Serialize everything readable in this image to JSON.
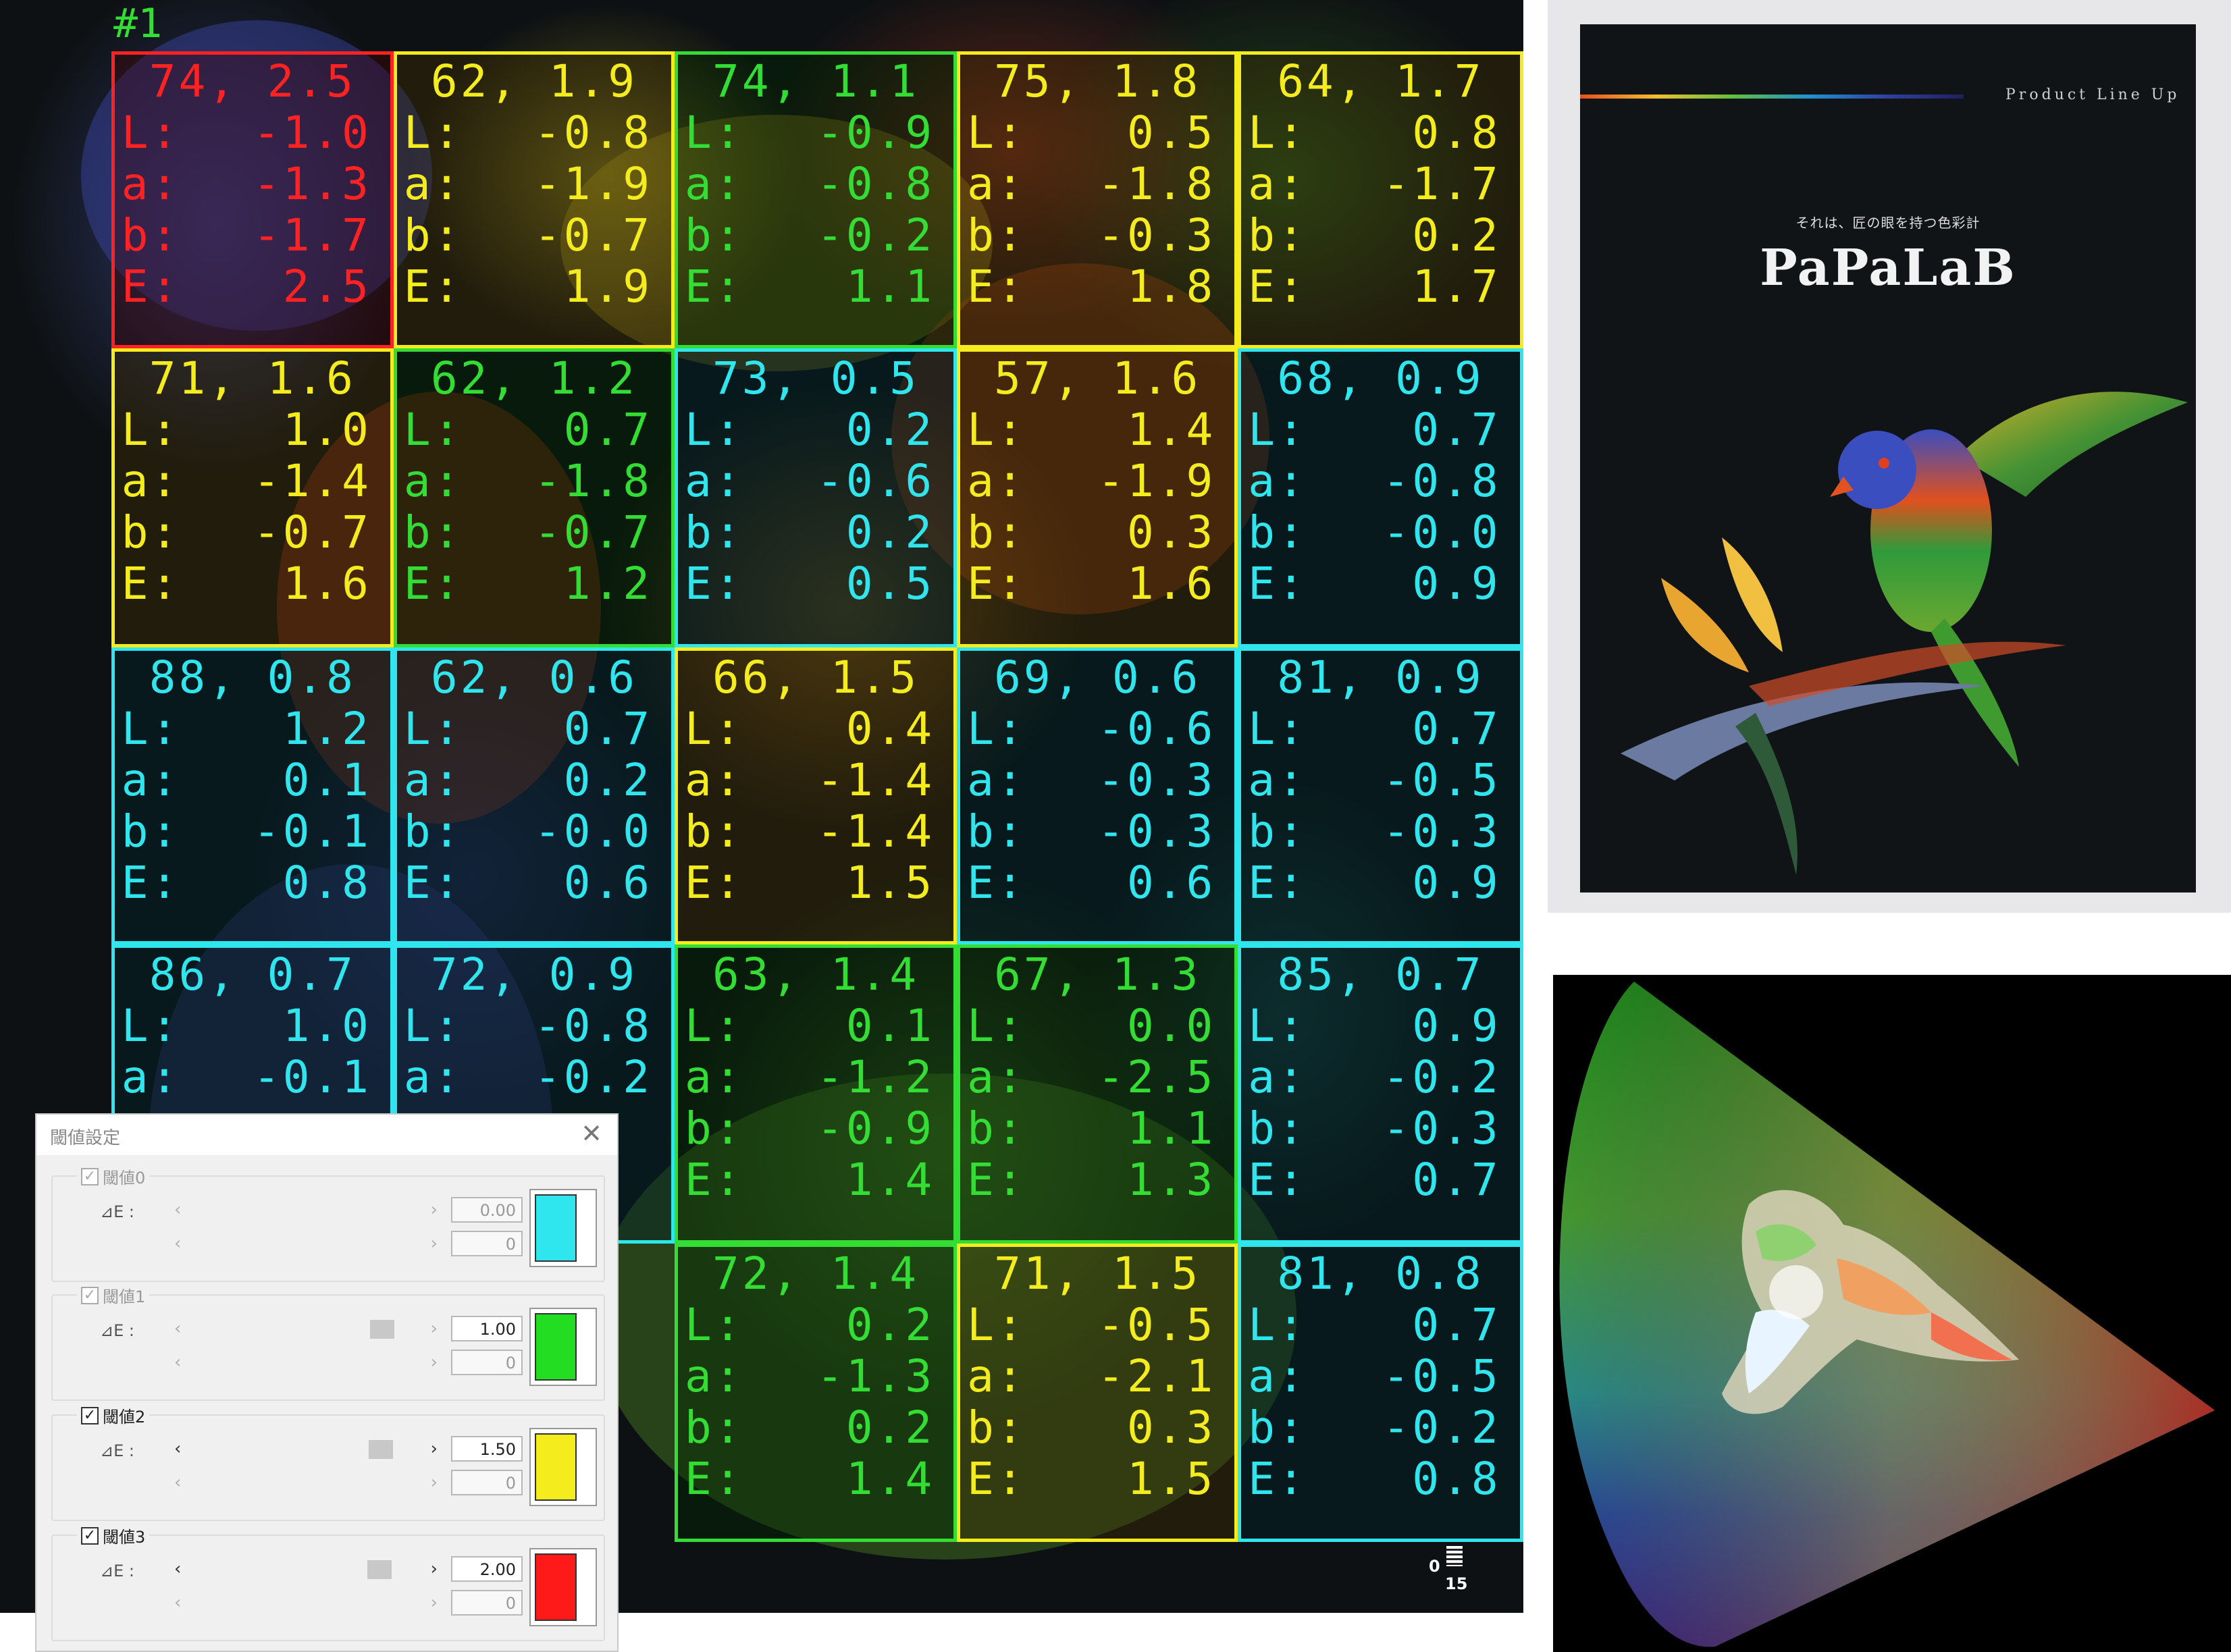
{
  "main": {
    "title": "#1",
    "scale": {
      "top": "0",
      "bottom": "15"
    },
    "cells": [
      {
        "level": "red",
        "cap": "74, 2.5",
        "L": "-1.0",
        "a": "-1.3",
        "b": "-1.7",
        "E": "2.5"
      },
      {
        "level": "yellow",
        "cap": "62, 1.9",
        "L": "-0.8",
        "a": "-1.9",
        "b": "-0.7",
        "E": "1.9"
      },
      {
        "level": "green",
        "cap": "74, 1.1",
        "L": "-0.9",
        "a": "-0.8",
        "b": "-0.2",
        "E": "1.1"
      },
      {
        "level": "yellow",
        "cap": "75, 1.8",
        "L": "0.5",
        "a": "-1.8",
        "b": "-0.3",
        "E": "1.8"
      },
      {
        "level": "yellow",
        "cap": "64, 1.7",
        "L": "0.8",
        "a": "-1.7",
        "b": "0.2",
        "E": "1.7"
      },
      {
        "level": "yellow",
        "cap": "71, 1.6",
        "L": "1.0",
        "a": "-1.4",
        "b": "-0.7",
        "E": "1.6"
      },
      {
        "level": "green",
        "cap": "62, 1.2",
        "L": "0.7",
        "a": "-1.8",
        "b": "-0.7",
        "E": "1.2"
      },
      {
        "level": "cyan",
        "cap": "73, 0.5",
        "L": "0.2",
        "a": "-0.6",
        "b": "0.2",
        "E": "0.5"
      },
      {
        "level": "yellow",
        "cap": "57, 1.6",
        "L": "1.4",
        "a": "-1.9",
        "b": "0.3",
        "E": "1.6"
      },
      {
        "level": "cyan",
        "cap": "68, 0.9",
        "L": "0.7",
        "a": "-0.8",
        "b": "-0.0",
        "E": "0.9"
      },
      {
        "level": "cyan",
        "cap": "88, 0.8",
        "L": "1.2",
        "a": "0.1",
        "b": "-0.1",
        "E": "0.8"
      },
      {
        "level": "cyan",
        "cap": "62, 0.6",
        "L": "0.7",
        "a": "0.2",
        "b": "-0.0",
        "E": "0.6"
      },
      {
        "level": "yellow",
        "cap": "66, 1.5",
        "L": "0.4",
        "a": "-1.4",
        "b": "-1.4",
        "E": "1.5"
      },
      {
        "level": "cyan",
        "cap": "69, 0.6",
        "L": "-0.6",
        "a": "-0.3",
        "b": "-0.3",
        "E": "0.6"
      },
      {
        "level": "cyan",
        "cap": "81, 0.9",
        "L": "0.7",
        "a": "-0.5",
        "b": "-0.3",
        "E": "0.9"
      },
      {
        "level": "cyan",
        "cap": "86, 0.7",
        "L": "1.0",
        "a": "-0.1",
        "b": "",
        "E": ""
      },
      {
        "level": "cyan",
        "cap": "72, 0.9",
        "L": "-0.8",
        "a": "-0.2",
        "b": "",
        "E": ""
      },
      {
        "level": "green",
        "cap": "63, 1.4",
        "L": "0.1",
        "a": "-1.2",
        "b": "-0.9",
        "E": "1.4"
      },
      {
        "level": "green",
        "cap": "67, 1.3",
        "L": "0.0",
        "a": "-2.5",
        "b": "1.1",
        "E": "1.3"
      },
      {
        "level": "cyan",
        "cap": "85, 0.7",
        "L": "0.9",
        "a": "-0.2",
        "b": "-0.3",
        "E": "0.7"
      },
      {
        "level": "hidden",
        "cap": "",
        "L": "",
        "a": "",
        "b": "",
        "E": ""
      },
      {
        "level": "hidden",
        "cap": "",
        "L": "",
        "a": "",
        "b": "",
        "E": ""
      },
      {
        "level": "green",
        "cap": "72, 1.4",
        "L": "0.2",
        "a": "-1.3",
        "b": "0.2",
        "E": "1.4"
      },
      {
        "level": "yellow",
        "cap": "71, 1.5",
        "L": "-0.5",
        "a": "-2.1",
        "b": "0.3",
        "E": "1.5"
      },
      {
        "level": "cyan",
        "cap": "81, 0.8",
        "L": "0.7",
        "a": "-0.5",
        "b": "-0.2",
        "E": "0.8"
      }
    ]
  },
  "dialog": {
    "title": "閾値設定",
    "delta_label": "⊿E :",
    "groups": [
      {
        "label": "閾値0",
        "checked": true,
        "enabled": false,
        "value": "0.00",
        "count": "0",
        "color": "#2fe6ee"
      },
      {
        "label": "閾値1",
        "checked": true,
        "enabled": false,
        "value": "1.00",
        "count": "0",
        "color": "#22dd22"
      },
      {
        "label": "閾値2",
        "checked": true,
        "enabled": true,
        "value": "1.50",
        "count": "0",
        "color": "#f4ec1c"
      },
      {
        "label": "閾値3",
        "checked": true,
        "enabled": true,
        "value": "2.00",
        "count": "0",
        "color": "#ff1a1a"
      }
    ]
  },
  "brochure": {
    "product_line": "Product Line Up",
    "tagline": "それは、匠の眼を持つ色彩計",
    "brand": "PaPaLaB"
  }
}
